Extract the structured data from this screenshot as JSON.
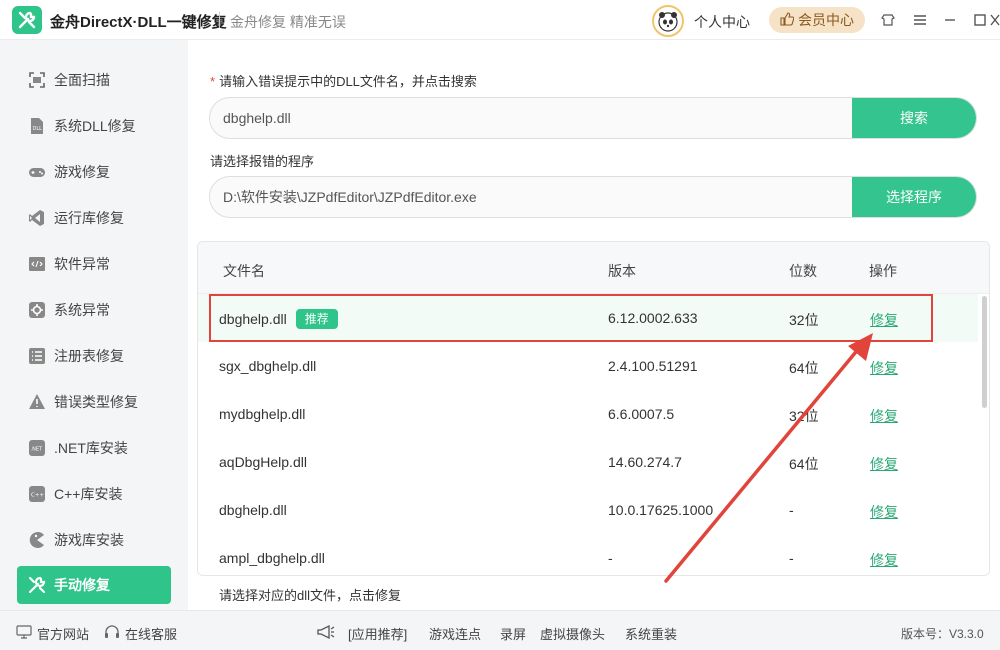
{
  "app": {
    "title": "金舟DirectX·DLL一键修复",
    "slogan": "金舟修复 精准无误",
    "user_center": "个人中心",
    "vip_label": "会员中心"
  },
  "sidebar": {
    "items": [
      {
        "label": "全面扫描",
        "icon": "scan-icon"
      },
      {
        "label": "系统DLL修复",
        "icon": "dll-icon"
      },
      {
        "label": "游戏修复",
        "icon": "gamepad-icon"
      },
      {
        "label": "运行库修复",
        "icon": "visual-studio-icon"
      },
      {
        "label": "软件异常",
        "icon": "code-window-icon"
      },
      {
        "label": "系统异常",
        "icon": "gear-icon"
      },
      {
        "label": "注册表修复",
        "icon": "list-icon"
      },
      {
        "label": "错误类型修复",
        "icon": "warning-icon"
      },
      {
        "label": ".NET库安装",
        "icon": "dotnet-icon"
      },
      {
        "label": "C++库安装",
        "icon": "cpp-icon"
      },
      {
        "label": "游戏库安装",
        "icon": "pacman-icon"
      },
      {
        "label": "手动修复",
        "icon": "wrench-icon"
      }
    ],
    "active": "手动修复"
  },
  "main": {
    "dll_label": "请输入错误提示中的DLL文件名，并点击搜索",
    "dll_required_mark": "*",
    "dll_value": "dbghelp.dll",
    "search_label": "搜索",
    "program_label": "请选择报错的程序",
    "program_value": "D:\\软件安装\\JZPdfEditor\\JZPdfEditor.exe",
    "choose_program_label": "选择程序",
    "table": {
      "headers": [
        "文件名",
        "版本",
        "位数",
        "操作"
      ],
      "rows": [
        {
          "name": "dbghelp.dll",
          "badge": "推荐",
          "version": "6.12.0002.633",
          "bits": "32位",
          "action": "修复"
        },
        {
          "name": "sgx_dbghelp.dll",
          "badge": "",
          "version": "2.4.100.51291",
          "bits": "64位",
          "action": "修复"
        },
        {
          "name": "mydbghelp.dll",
          "badge": "",
          "version": "6.6.0007.5",
          "bits": "32位",
          "action": "修复"
        },
        {
          "name": "aqDbgHelp.dll",
          "badge": "",
          "version": "14.60.274.7",
          "bits": "64位",
          "action": "修复"
        },
        {
          "name": "dbghelp.dll",
          "badge": "",
          "version": "10.0.17625.1000",
          "bits": "-",
          "action": "修复"
        },
        {
          "name": "ampl_dbghelp.dll",
          "badge": "",
          "version": "-",
          "bits": "-",
          "action": "修复"
        }
      ]
    },
    "hint": "请选择对应的dll文件，点击修复"
  },
  "footer": {
    "official_site": "官方网站",
    "online_service": "在线客服",
    "links": [
      "[应用推荐]",
      "游戏连点",
      "录屏",
      "虚拟摄像头",
      "系统重装"
    ],
    "version": "版本号：V3.3.0"
  },
  "colors": {
    "accent": "#2ec48a",
    "highlight": "#e0443a",
    "vip_bg": "#f6e2c6"
  }
}
